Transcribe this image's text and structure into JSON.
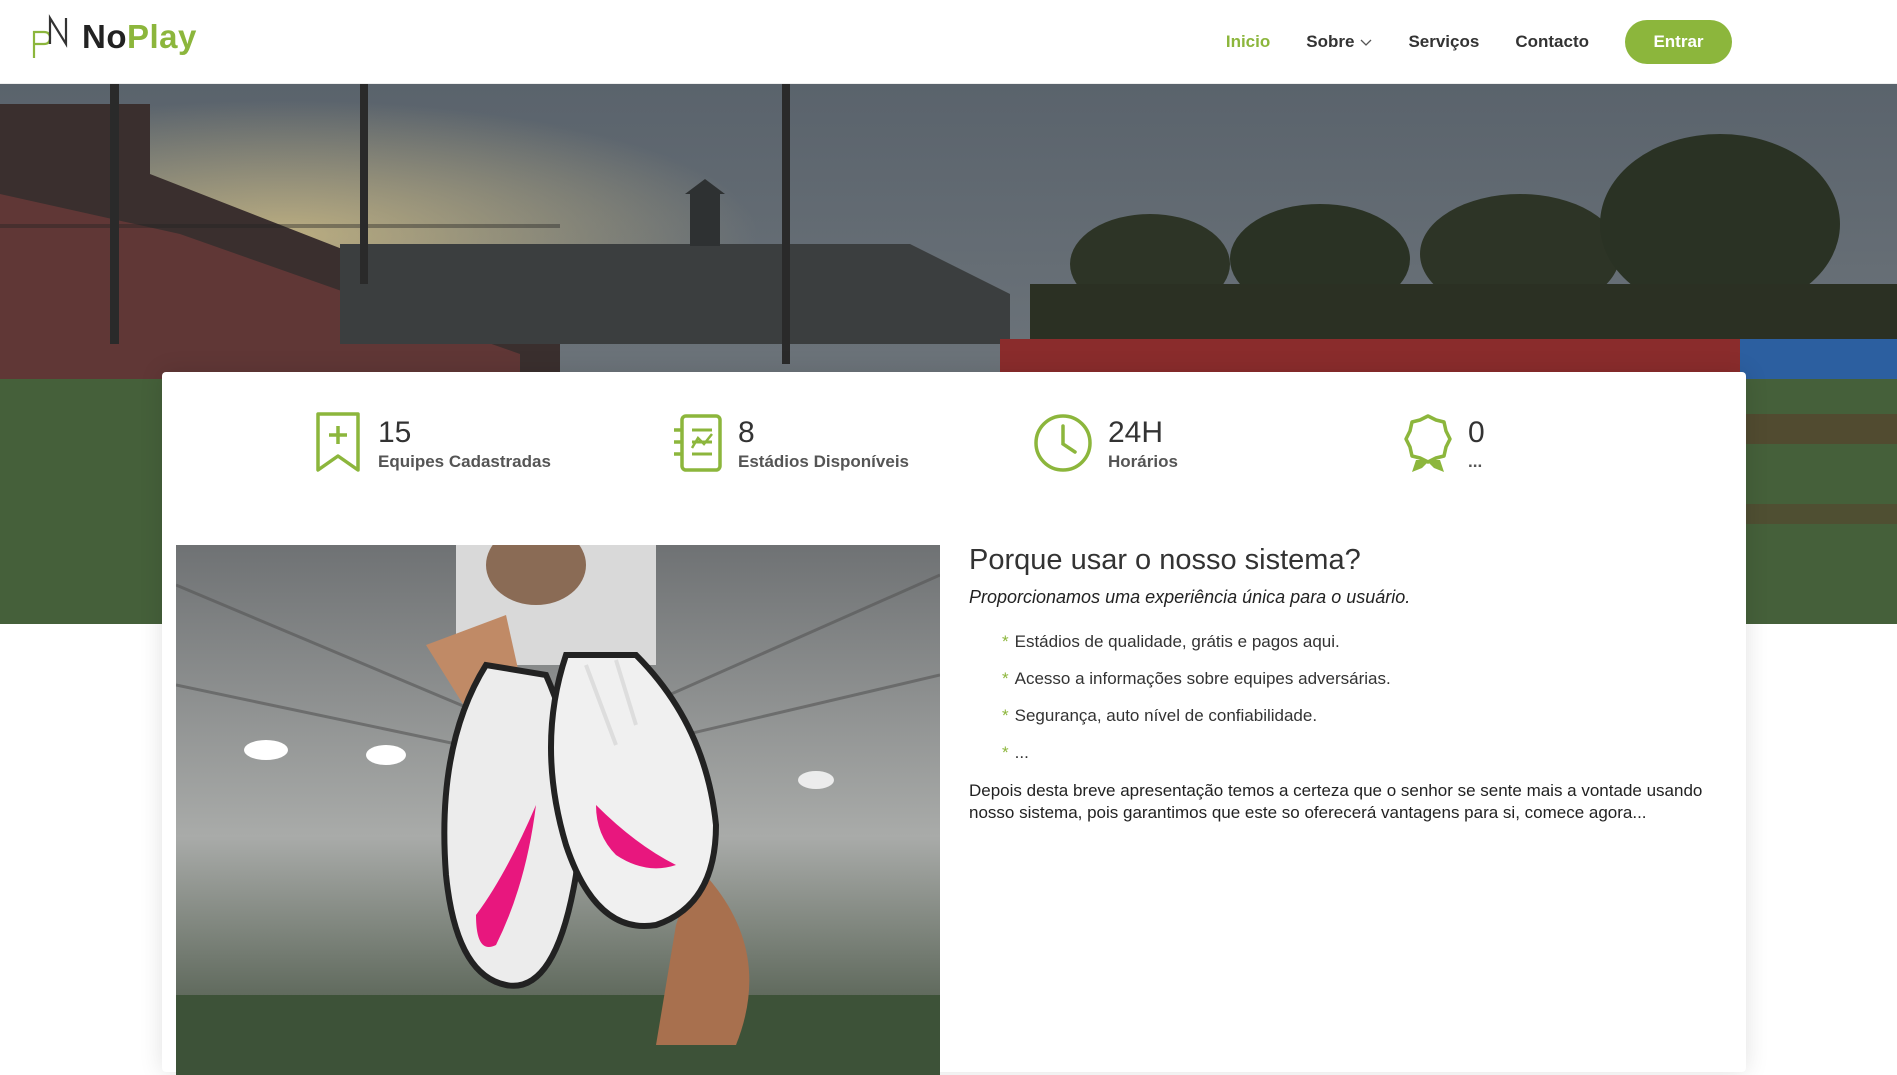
{
  "brand": {
    "name_part1": "No",
    "name_part2": "Play",
    "accent": "#8cb63c"
  },
  "nav": {
    "items": [
      {
        "label": "Inicio",
        "active": true
      },
      {
        "label": "Sobre",
        "dropdown": true
      },
      {
        "label": "Serviços"
      },
      {
        "label": "Contacto"
      }
    ],
    "enter_label": "Entrar"
  },
  "stats": [
    {
      "icon": "bookmark-plus-icon",
      "value": "15",
      "label": "Equipes Cadastradas"
    },
    {
      "icon": "checklist-icon",
      "value": "8",
      "label": "Estádios Disponíveis"
    },
    {
      "icon": "clock-icon",
      "value": "24H",
      "label": "Horários"
    },
    {
      "icon": "award-icon",
      "value": "0",
      "label": "..."
    }
  ],
  "about": {
    "title": "Porque usar o nosso sistema?",
    "subtitle": "Proporcionamos uma experiência única para o usuário.",
    "bullets": [
      "Estádios de qualidade, grátis e pagos aqui.",
      "Acesso a informações sobre equipes adversárias.",
      "Segurança, auto nível de confiabilidade.",
      "..."
    ],
    "paragraph": "Depois desta breve apresentação temos a certeza que o senhor se sente mais a vontade usando nosso sistema, pois garantimos que este so oferecerá vantagens para si, comece agora..."
  }
}
